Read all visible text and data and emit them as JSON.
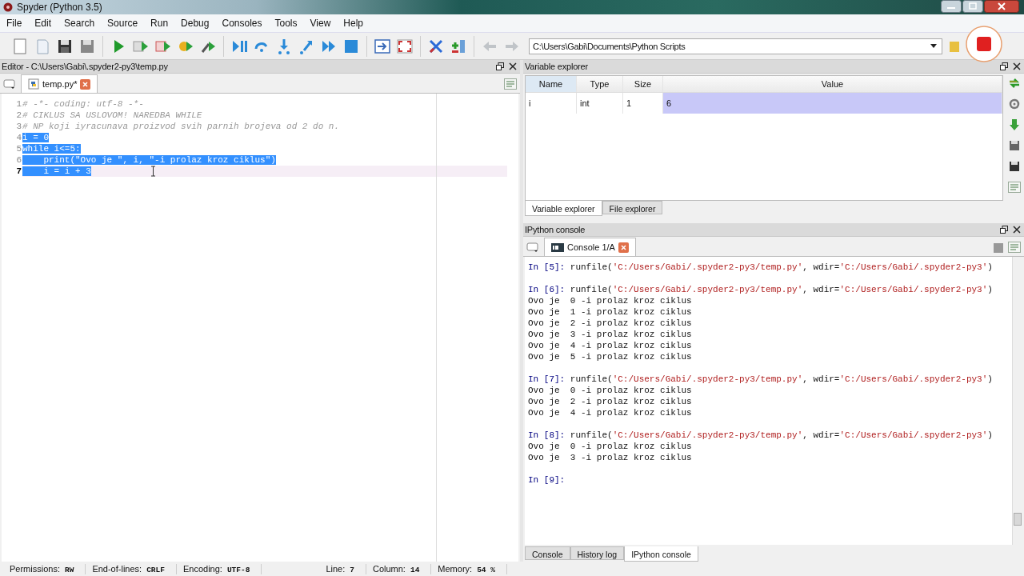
{
  "window": {
    "title": "Spyder (Python 3.5)"
  },
  "menu": [
    "File",
    "Edit",
    "Search",
    "Source",
    "Run",
    "Debug",
    "Consoles",
    "Tools",
    "View",
    "Help"
  ],
  "path_field": {
    "value": "C:\\Users\\Gabi\\Documents\\Python Scripts"
  },
  "editor": {
    "title": "Editor - C:\\Users\\Gabi\\.spyder2-py3\\temp.py",
    "tabs": [
      {
        "label": "temp.py*",
        "selected": true
      }
    ],
    "lines": [
      {
        "number": "1",
        "text": "# -*- coding: utf-8 -*-",
        "kind": "comment",
        "selected": false,
        "current": false
      },
      {
        "number": "2",
        "text": "# CIKLUS SA USLOVOM! NAREDBA WHILE",
        "kind": "comment",
        "selected": false,
        "current": false
      },
      {
        "number": "3",
        "text": "# NP koji iyracunava proizvod svih parnih brojeva od 2 do n.",
        "kind": "comment",
        "selected": false,
        "current": false
      },
      {
        "number": "4",
        "text": "i = 0",
        "kind": "code",
        "selected": true,
        "current": false
      },
      {
        "number": "5",
        "text": "while i<=5:",
        "kind": "code",
        "selected": true,
        "current": false
      },
      {
        "number": "6",
        "text": "    print(\"Ovo je \", i, \"-i prolaz kroz ciklus\")",
        "kind": "code",
        "selected": true,
        "current": false
      },
      {
        "number": "7",
        "text": "    i = i + 3",
        "kind": "code",
        "selected": true,
        "current": true
      }
    ]
  },
  "variable_explorer": {
    "title": "Variable explorer",
    "columns": [
      "Name",
      "Type",
      "Size",
      "Value"
    ],
    "rows": [
      {
        "name": "i",
        "type": "int",
        "size": "1",
        "value": "6",
        "selected": true
      }
    ],
    "tabs": [
      {
        "label": "Variable explorer",
        "selected": true
      },
      {
        "label": "File explorer",
        "selected": false
      }
    ]
  },
  "console": {
    "title": "IPython console",
    "tabs": [
      {
        "label": "Console 1/A",
        "selected": true
      }
    ],
    "lines": [
      {
        "kind": "input",
        "prompt": "In [5]:",
        "parts": [
          {
            "text": "runfile(",
            "kind": "code"
          },
          {
            "text": "'C:/Users/Gabi/.spyder2-py3/temp.py'",
            "kind": "string"
          },
          {
            "text": ", wdir=",
            "kind": "code"
          },
          {
            "text": "'C:/Users/Gabi/.spyder2-py3'",
            "kind": "string"
          },
          {
            "text": ")",
            "kind": "code"
          }
        ]
      },
      {
        "kind": "blank"
      },
      {
        "kind": "input",
        "prompt": "In [6]:",
        "parts": [
          {
            "text": "runfile(",
            "kind": "code"
          },
          {
            "text": "'C:/Users/Gabi/.spyder2-py3/temp.py'",
            "kind": "string"
          },
          {
            "text": ", wdir=",
            "kind": "code"
          },
          {
            "text": "'C:/Users/Gabi/.spyder2-py3'",
            "kind": "string"
          },
          {
            "text": ")",
            "kind": "code"
          }
        ]
      },
      {
        "kind": "output",
        "text": "Ovo je  0 -i prolaz kroz ciklus"
      },
      {
        "kind": "output",
        "text": "Ovo je  1 -i prolaz kroz ciklus"
      },
      {
        "kind": "output",
        "text": "Ovo je  2 -i prolaz kroz ciklus"
      },
      {
        "kind": "output",
        "text": "Ovo je  3 -i prolaz kroz ciklus"
      },
      {
        "kind": "output",
        "text": "Ovo je  4 -i prolaz kroz ciklus"
      },
      {
        "kind": "output",
        "text": "Ovo je  5 -i prolaz kroz ciklus"
      },
      {
        "kind": "blank"
      },
      {
        "kind": "input",
        "prompt": "In [7]:",
        "parts": [
          {
            "text": "runfile(",
            "kind": "code"
          },
          {
            "text": "'C:/Users/Gabi/.spyder2-py3/temp.py'",
            "kind": "string"
          },
          {
            "text": ", wdir=",
            "kind": "code"
          },
          {
            "text": "'C:/Users/Gabi/.spyder2-py3'",
            "kind": "string"
          },
          {
            "text": ")",
            "kind": "code"
          }
        ]
      },
      {
        "kind": "output",
        "text": "Ovo je  0 -i prolaz kroz ciklus"
      },
      {
        "kind": "output",
        "text": "Ovo je  2 -i prolaz kroz ciklus"
      },
      {
        "kind": "output",
        "text": "Ovo je  4 -i prolaz kroz ciklus"
      },
      {
        "kind": "blank"
      },
      {
        "kind": "input",
        "prompt": "In [8]:",
        "parts": [
          {
            "text": "runfile(",
            "kind": "code"
          },
          {
            "text": "'C:/Users/Gabi/.spyder2-py3/temp.py'",
            "kind": "string"
          },
          {
            "text": ", wdir=",
            "kind": "code"
          },
          {
            "text": "'C:/Users/Gabi/.spyder2-py3'",
            "kind": "string"
          },
          {
            "text": ")",
            "kind": "code"
          }
        ]
      },
      {
        "kind": "output",
        "text": "Ovo je  0 -i prolaz kroz ciklus"
      },
      {
        "kind": "output",
        "text": "Ovo je  3 -i prolaz kroz ciklus"
      },
      {
        "kind": "blank"
      },
      {
        "kind": "input",
        "prompt": "In [9]:"
      }
    ],
    "bottom_tabs": [
      {
        "label": "Console",
        "selected": false
      },
      {
        "label": "History log",
        "selected": false
      },
      {
        "label": "IPython console",
        "selected": true
      }
    ]
  },
  "status_bar": [
    {
      "label": "Permissions:",
      "value": "RW"
    },
    {
      "label": "End-of-lines:",
      "value": "CRLF"
    },
    {
      "label": "Encoding:",
      "value": "UTF-8"
    },
    {
      "label": "Line:",
      "value": "7"
    },
    {
      "label": "Column:",
      "value": "14"
    },
    {
      "label": "Memory:",
      "value": "54 %"
    }
  ]
}
